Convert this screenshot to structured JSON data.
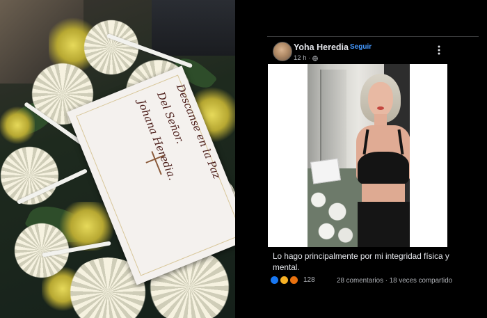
{
  "left_photo": {
    "card_text": [
      "Descanse en la Paz",
      "Del Señor.",
      "Johana Heredia."
    ]
  },
  "post": {
    "author": "Yoha Heredia",
    "follow_label": "Seguir",
    "time": "12 h ·",
    "caption": "Lo hago principalmente por mi integridad física y mental.",
    "reaction_count": "128",
    "comments": "28 comentarios",
    "separator": "·",
    "shares": "18 veces compartido",
    "icons": [
      "globe-icon",
      "more-icon",
      "like-icon",
      "sad-icon",
      "angry-icon"
    ]
  },
  "colors": {
    "background": "#000000",
    "text_primary": "#e4e6eb",
    "text_secondary": "#b0b3b8",
    "link_blue": "#4599ff"
  }
}
